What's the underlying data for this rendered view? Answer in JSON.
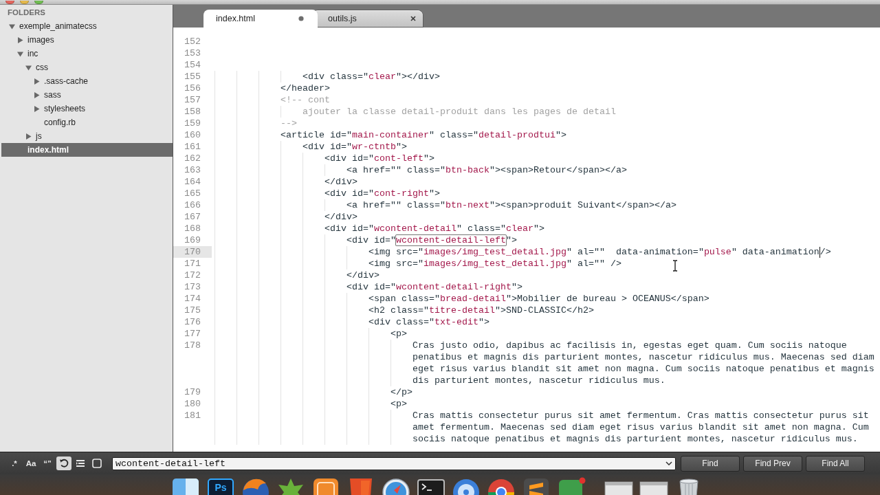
{
  "sidebar": {
    "heading": "FOLDERS",
    "tree": [
      {
        "name": "exemple_animatecss",
        "kind": "folder",
        "expanded": true,
        "selected": false,
        "children": [
          {
            "name": "images",
            "kind": "folder",
            "expanded": false,
            "selected": false
          },
          {
            "name": "inc",
            "kind": "folder",
            "expanded": true,
            "selected": false,
            "children": [
              {
                "name": "css",
                "kind": "folder",
                "expanded": true,
                "selected": false,
                "children": [
                  {
                    "name": ".sass-cache",
                    "kind": "folder",
                    "expanded": false,
                    "selected": false
                  },
                  {
                    "name": "sass",
                    "kind": "folder",
                    "expanded": false,
                    "selected": false
                  },
                  {
                    "name": "stylesheets",
                    "kind": "folder",
                    "expanded": false,
                    "selected": false
                  },
                  {
                    "name": "config.rb",
                    "kind": "file",
                    "selected": false
                  }
                ]
              },
              {
                "name": "js",
                "kind": "folder",
                "expanded": false,
                "selected": false
              }
            ]
          },
          {
            "name": "index.html",
            "kind": "file",
            "selected": true
          }
        ]
      }
    ]
  },
  "tabs": [
    {
      "label": "index.html",
      "selected": true,
      "modified": true
    },
    {
      "label": "outils.js",
      "selected": false,
      "modified": false
    }
  ],
  "editor": {
    "lines": [
      {
        "number": "152",
        "current": false
      },
      {
        "number": "153",
        "current": false
      },
      {
        "number": "154",
        "current": false
      },
      {
        "number": "155",
        "kind": "code",
        "current": false,
        "text": "                <div class=\"clear\"></div>"
      },
      {
        "number": "156",
        "kind": "code",
        "current": false,
        "text": "            </header>"
      },
      {
        "number": "157",
        "kind": "comment",
        "current": false,
        "text": "            <!-- cont"
      },
      {
        "number": "158",
        "kind": "comment",
        "current": false,
        "text": "                ajouter la classe detail-produit dans les pages de detail"
      },
      {
        "number": "159",
        "kind": "comment",
        "current": false,
        "text": "            -->"
      },
      {
        "number": "160",
        "kind": "code",
        "current": false,
        "text": "            <article id=\"main-container\" class=\"detail-prodtui\">"
      },
      {
        "number": "161",
        "kind": "code",
        "current": false,
        "text": "                <div id=\"wr-ctntb\">"
      },
      {
        "number": "162",
        "kind": "code",
        "current": false,
        "text": "                    <div id=\"cont-left\">"
      },
      {
        "number": "163",
        "kind": "code",
        "current": false,
        "text": "                        <a href=\"\" class=\"btn-back\"><span>Retour</span></a>"
      },
      {
        "number": "164",
        "kind": "code",
        "current": false,
        "text": "                    </div>"
      },
      {
        "number": "165",
        "kind": "code",
        "current": false,
        "text": "                    <div id=\"cont-right\">"
      },
      {
        "number": "166",
        "kind": "code",
        "current": false,
        "text": "                        <a href=\"\" class=\"btn-next\"><span>produit Suivant</span></a>"
      },
      {
        "number": "167",
        "kind": "code",
        "current": false,
        "text": "                    </div>"
      },
      {
        "number": "168",
        "kind": "code",
        "current": false,
        "text": "                    <div id=\"wcontent-detail\" class=\"clear\">"
      },
      {
        "number": "169",
        "kind": "code",
        "current": false,
        "parts": [
          {
            "text": "                        <div id=\"",
            "found": false,
            "caret_after": false
          },
          {
            "text": "wcontent-detail-left",
            "found": true,
            "caret_after": false
          },
          {
            "text": "\">",
            "found": false,
            "caret_after": false
          }
        ]
      },
      {
        "number": "170",
        "kind": "code",
        "current": true,
        "parts": [
          {
            "text": "                            <img src=\"images/img_test_detail.jpg\" al=\"\"  data-animation=\"pulse\" data-animation",
            "found": false,
            "caret_after": true
          },
          {
            "text": "/>",
            "found": false,
            "caret_after": false
          }
        ]
      },
      {
        "number": "171",
        "kind": "code",
        "current": false,
        "text": "                            <img src=\"images/img_test_detail.jpg\" al=\"\" />"
      },
      {
        "number": "172",
        "kind": "code",
        "current": false,
        "text": "                        </div>"
      },
      {
        "number": "173",
        "kind": "code",
        "current": false,
        "text": "                        <div id=\"wcontent-detail-right\">"
      },
      {
        "number": "174",
        "kind": "code",
        "current": false,
        "text": "                            <span class=\"bread-detail\">Mobilier de bureau > OCEANUS</span>"
      },
      {
        "number": "175",
        "kind": "code",
        "current": false,
        "text": "                            <h2 class=\"titre-detail\">SND-CLASSIC</h2>"
      },
      {
        "number": "176",
        "kind": "code",
        "current": false,
        "text": "                            <div class=\"txt-edit\">"
      },
      {
        "number": "177",
        "kind": "code",
        "current": false,
        "text": "                                <p>"
      },
      {
        "number": "178",
        "kind": "code",
        "current": false,
        "text": "                                    Cras justo odio, dapibus ac facilisis in, egestas eget quam. Cum sociis natoque penatibus et magnis dis parturient montes, nascetur ridiculus mus. Maecenas sed diam eget risus varius blandit sit amet non magna. Cum sociis natoque penatibus et magnis dis parturient montes, nascetur ridiculus mus."
      },
      {
        "number": "179",
        "kind": "code",
        "current": false,
        "text": "                                </p>"
      },
      {
        "number": "180",
        "kind": "code",
        "current": false,
        "text": "                                <p>"
      },
      {
        "number": "181",
        "kind": "code",
        "current": false,
        "text": "                                    Cras mattis consectetur purus sit amet fermentum. Cras mattis consectetur purus sit amet fermentum. Maecenas sed diam eget risus varius blandit sit amet non magna. Cum sociis natoque penatibus et magnis dis parturient montes, nascetur ridiculus mus."
      }
    ]
  },
  "find_panel": {
    "options": [
      {
        "kind": "text",
        "label": ".*",
        "on": false
      },
      {
        "kind": "text",
        "label": "Aa",
        "on": false
      },
      {
        "kind": "text",
        "label": "“”",
        "on": false
      },
      {
        "kind": "wrap",
        "on": true
      },
      {
        "kind": "selection",
        "on": false
      },
      {
        "kind": "highlight",
        "on": false
      }
    ],
    "query": "wcontent-detail-left",
    "buttons": [
      "Find",
      "Find Prev",
      "Find All"
    ]
  },
  "dock": {
    "apps": [
      {
        "kind": "face"
      },
      {
        "kind": "letters",
        "label": "Ps"
      },
      {
        "kind": "globe"
      },
      {
        "kind": "star"
      },
      {
        "kind": "box"
      },
      {
        "kind": "shield"
      },
      {
        "kind": "compass"
      },
      {
        "kind": "terminal"
      },
      {
        "kind": "disc"
      },
      {
        "kind": "wheel"
      },
      {
        "kind": "slab"
      },
      {
        "kind": "badged"
      }
    ],
    "extras": [
      {
        "kind": "window"
      },
      {
        "kind": "window"
      },
      {
        "kind": "bin"
      }
    ]
  }
}
